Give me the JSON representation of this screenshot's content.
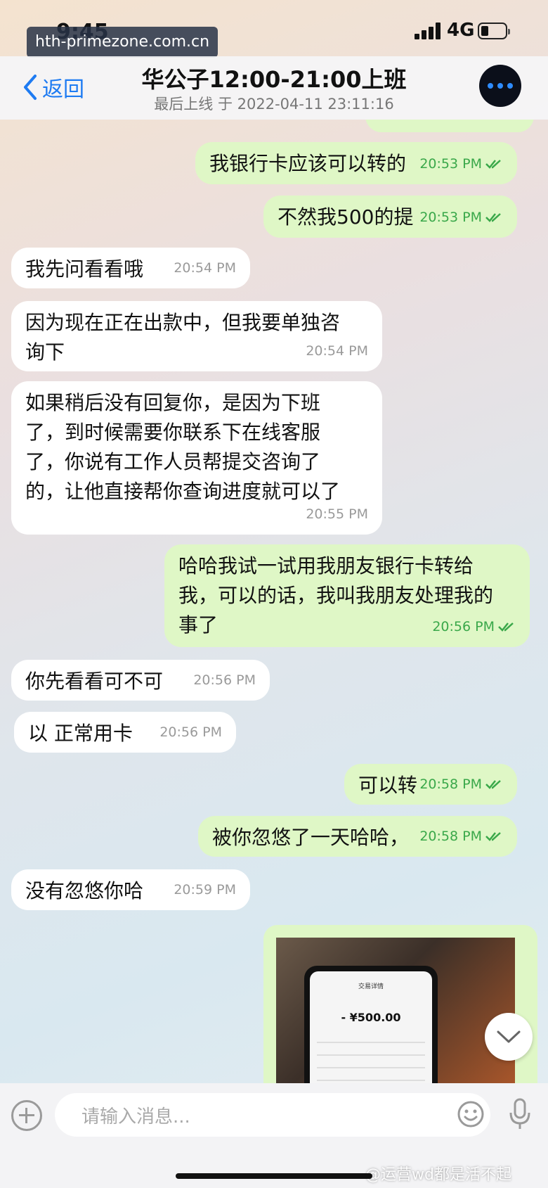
{
  "status": {
    "time": "9:45",
    "network": "4G"
  },
  "watermark": "hth-primezone.com.cn",
  "header": {
    "back_label": "返回",
    "title": "华公子12:00-21:00上班",
    "last_seen": "最后上线 于 2022-04-11 23:11:16"
  },
  "messages": [
    {
      "side": "out",
      "lines": [
        "我银行卡应该可以转的"
      ],
      "time": "20:53 PM"
    },
    {
      "side": "out",
      "lines": [
        "不然我500的提"
      ],
      "time": "20:53 PM"
    },
    {
      "side": "in",
      "lines": [
        "我先问看看哦"
      ],
      "time": "20:54 PM"
    },
    {
      "side": "in",
      "lines": [
        "因为现在正在出款中，但我要单独咨",
        "询下"
      ],
      "time": "20:54 PM"
    },
    {
      "side": "in",
      "lines": [
        "如果稍后没有回复你，是因为下班",
        "了，到时候需要你联系下在线客服",
        "了，你说有工作人员帮提交咨询了",
        "的，让他直接帮你查询进度就可以了"
      ],
      "time": "20:55 PM"
    },
    {
      "side": "out",
      "lines": [
        "哈哈我试一试用我朋友银行卡转给",
        "我，可以的话，我叫我朋友处理我的",
        "事了"
      ],
      "time": "20:56 PM"
    },
    {
      "side": "in",
      "lines": [
        "你先看看可不可"
      ],
      "time": "20:56 PM"
    },
    {
      "side": "in",
      "lines": [
        "以 正常用卡"
      ],
      "time": "20:56 PM"
    },
    {
      "side": "out",
      "lines": [
        "可以转"
      ],
      "time": "20:58 PM"
    },
    {
      "side": "out",
      "lines": [
        "被你忽悠了一天哈哈，"
      ],
      "time": "20:58 PM"
    },
    {
      "side": "in",
      "lines": [
        "没有忽悠你哈"
      ],
      "time": "20:59 PM"
    }
  ],
  "photo": {
    "screen_title": "交易详情",
    "amount": "- ¥500.00"
  },
  "input": {
    "placeholder": "请输入消息..."
  },
  "credit": "@运营wd都是活不起",
  "colors": {
    "outgoing_bubble": "#dff7c6",
    "incoming_bubble": "#ffffff",
    "accent": "#1e7bf2"
  }
}
